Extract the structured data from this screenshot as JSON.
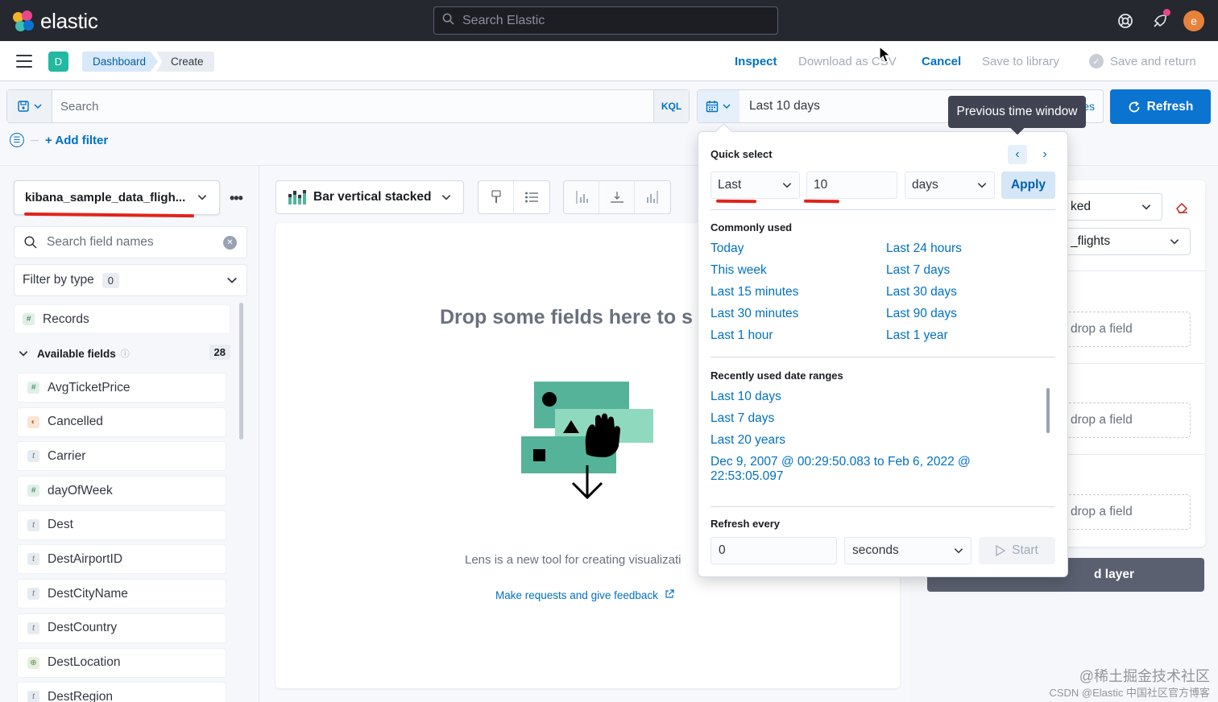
{
  "header": {
    "brand": "elastic",
    "search_placeholder": "Search Elastic",
    "help_icon": "help-icon",
    "news_icon": "newsfeed-icon",
    "avatar_initial": "e"
  },
  "nav": {
    "space_initial": "D",
    "breadcrumbs": [
      "Dashboard",
      "Create"
    ],
    "inspect": "Inspect",
    "download_csv": "Download as CSV",
    "cancel": "Cancel",
    "save_to_library": "Save to library",
    "save_and_return": "Save and return"
  },
  "querybar": {
    "placeholder": "Search",
    "language": "KQL",
    "date_range": "Last 10 days",
    "date_tail": "es",
    "refresh": "Refresh",
    "tooltip": "Previous time window",
    "add_filter": "+ Add filter"
  },
  "left_panel": {
    "index_pattern": "kibana_sample_data_fligh...",
    "field_search_placeholder": "Search field names",
    "filter_by_type": "Filter by type",
    "filter_count": "0",
    "records": "Records",
    "available_fields": "Available fields",
    "available_count": "28",
    "fields": [
      {
        "name": "AvgTicketPrice",
        "type": "#"
      },
      {
        "name": "Cancelled",
        "type": "b"
      },
      {
        "name": "Carrier",
        "type": "t"
      },
      {
        "name": "dayOfWeek",
        "type": "#"
      },
      {
        "name": "Dest",
        "type": "t"
      },
      {
        "name": "DestAirportID",
        "type": "t"
      },
      {
        "name": "DestCityName",
        "type": "t"
      },
      {
        "name": "DestCountry",
        "type": "t"
      },
      {
        "name": "DestLocation",
        "type": "g"
      },
      {
        "name": "DestRegion",
        "type": "t"
      }
    ]
  },
  "workspace": {
    "chart_type": "Bar vertical stacked",
    "drop_title": "Drop some fields here to s",
    "lens_text": "Lens is a new tool for creating visualizati",
    "feedback_link": "Make requests and give feedback"
  },
  "right_panel": {
    "stacked_label": "ked",
    "index_label": "_flights",
    "drop_field": "drop a field",
    "add_layer": "d layer"
  },
  "popover": {
    "quick_select": "Quick select",
    "tense": "Last",
    "amount": "10",
    "unit": "days",
    "apply": "Apply",
    "commonly_used": "Commonly used",
    "common_left": [
      "Today",
      "This week",
      "Last 15 minutes",
      "Last 30 minutes",
      "Last 1 hour"
    ],
    "common_right": [
      "Last 24 hours",
      "Last 7 days",
      "Last 30 days",
      "Last 90 days",
      "Last 1 year"
    ],
    "recently_used": "Recently used date ranges",
    "recent": [
      "Last 10 days",
      "Last 7 days",
      "Last 20 years",
      "Dec 9, 2007 @ 00:29:50.083 to Feb 6, 2022 @",
      "22:53:05.097"
    ],
    "refresh_every": "Refresh every",
    "refresh_value": "0",
    "refresh_unit": "seconds",
    "start": "Start"
  },
  "watermark": {
    "line1": "@稀土掘金技术社区",
    "line2": "CSDN @Elastic 中国社区官方博客"
  },
  "colors": {
    "accent": "#0071c2",
    "refresh_bg": "#0b74d0",
    "header_bg": "#25282f",
    "annotation_red": "#e2231a",
    "illustration_green": "#54b399"
  }
}
